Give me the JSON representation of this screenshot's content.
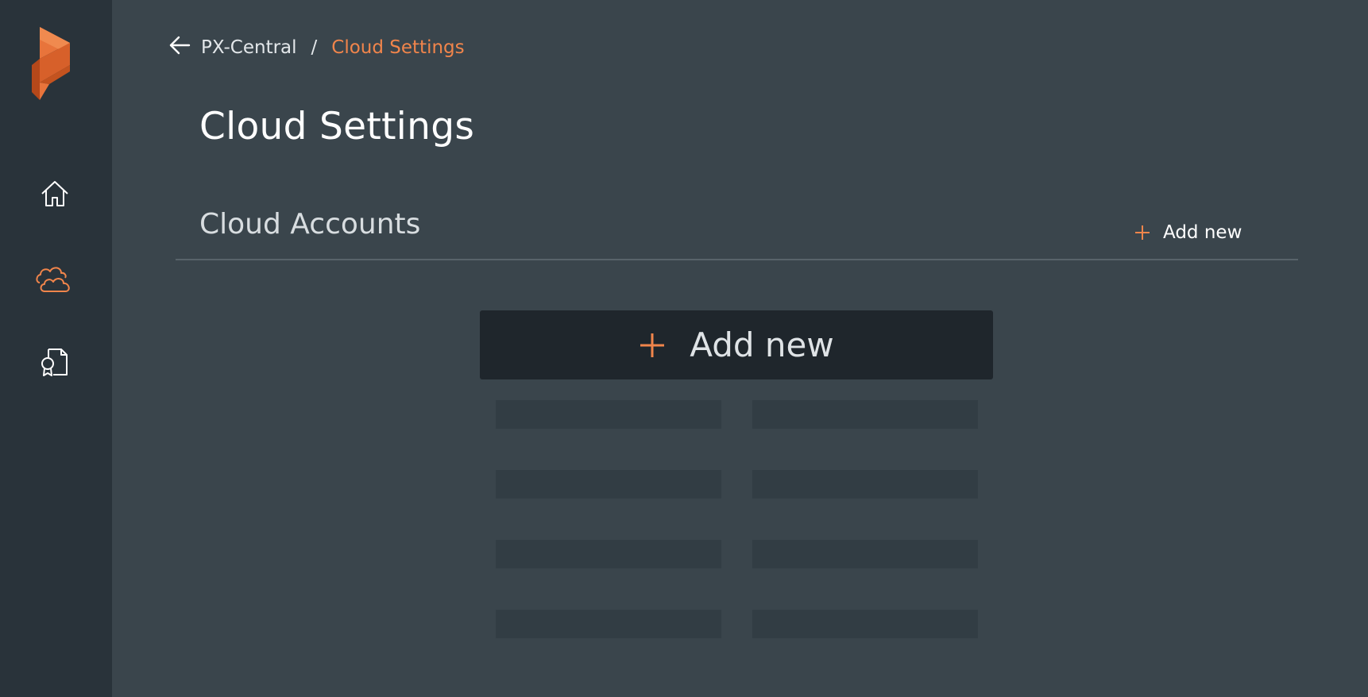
{
  "sidebar": {
    "logo": "portworx-logo",
    "items": [
      {
        "icon": "home-icon",
        "active": false
      },
      {
        "icon": "cloud-icon",
        "active": true
      },
      {
        "icon": "license-document-icon",
        "active": false
      }
    ]
  },
  "breadcrumb": {
    "back_icon": "arrow-left-icon",
    "root": "PX-Central",
    "separator": "/",
    "current": "Cloud Settings"
  },
  "page": {
    "title": "Cloud Settings"
  },
  "section": {
    "title": "Cloud Accounts",
    "add_label": "Add new"
  },
  "empty_state": {
    "add_label": "Add new",
    "placeholder_rows": 4,
    "placeholder_columns": 2
  },
  "colors": {
    "accent": "#f1854b",
    "sidebar_bg": "#29333a",
    "main_bg": "#3a454c",
    "card_bg": "#1f262c"
  }
}
